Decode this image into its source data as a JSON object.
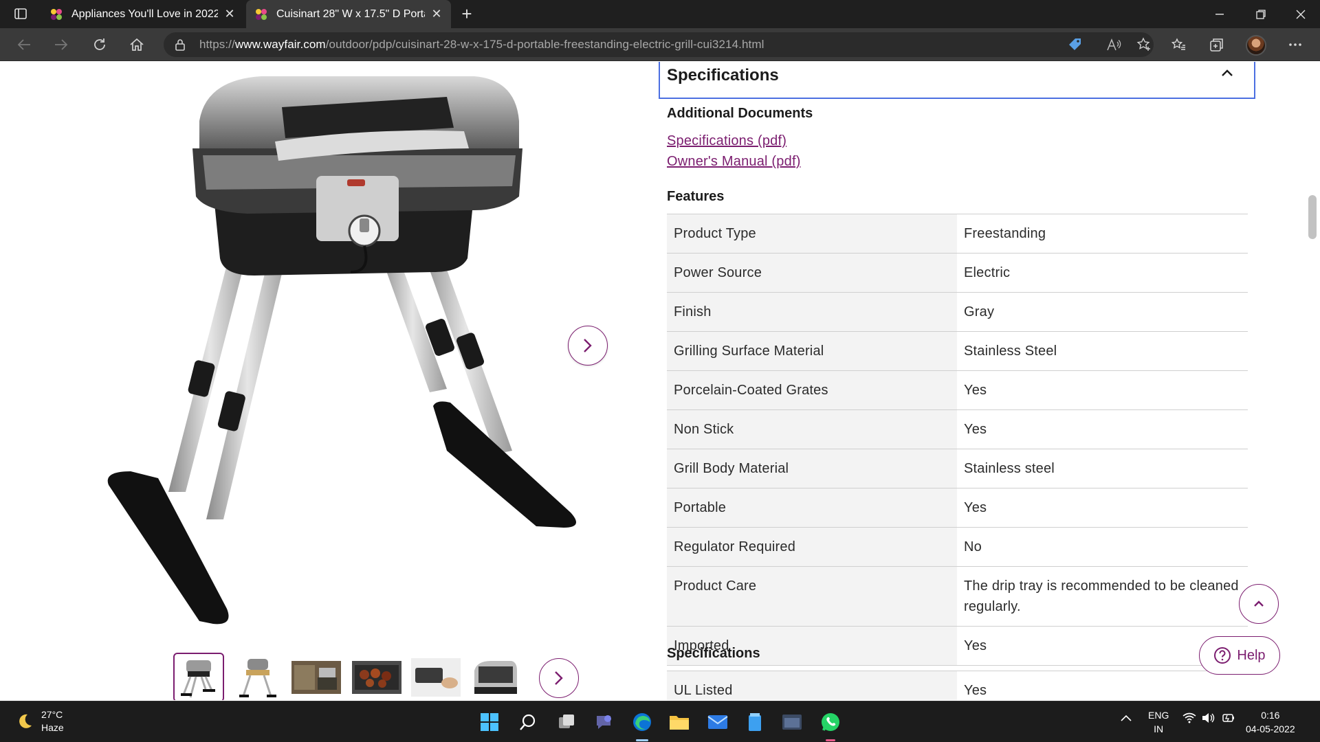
{
  "browser": {
    "tabs": [
      {
        "title": "Appliances You'll Love in 2022 | W",
        "active": false
      },
      {
        "title": "Cuisinart 28\" W x 17.5\" D Portab",
        "active": true
      }
    ],
    "url_prefix": "https://",
    "url_host": "www.wayfair.com",
    "url_path": "/outdoor/pdp/cuisinart-28-w-x-175-d-portable-freestanding-electric-grill-cui3214.html"
  },
  "page": {
    "spec_panel_title": "Specifications",
    "additional_documents": {
      "heading": "Additional Documents",
      "links": [
        "Specifications (pdf)",
        "Owner's Manual (pdf)"
      ]
    },
    "features": {
      "heading": "Features",
      "rows": [
        {
          "label": "Product Type",
          "value": "Freestanding"
        },
        {
          "label": "Power Source",
          "value": "Electric"
        },
        {
          "label": "Finish",
          "value": "Gray"
        },
        {
          "label": "Grilling Surface Material",
          "value": "Stainless Steel"
        },
        {
          "label": "Porcelain-Coated Grates",
          "value": "Yes"
        },
        {
          "label": "Non Stick",
          "value": "Yes"
        },
        {
          "label": "Grill Body Material",
          "value": "Stainless steel"
        },
        {
          "label": "Portable",
          "value": "Yes"
        },
        {
          "label": "Regulator Required",
          "value": "No"
        },
        {
          "label": "Product Care",
          "value": "The drip tray is recommended to be cleaned regularly."
        },
        {
          "label": "Imported",
          "value": "Yes"
        }
      ]
    },
    "specifications": {
      "heading": "Specifications",
      "rows": [
        {
          "label": "UL Listed",
          "value": "Yes"
        }
      ]
    },
    "help_label": "Help"
  },
  "taskbar": {
    "temperature": "27°C",
    "weather": "Haze",
    "language_top": "ENG",
    "language_bottom": "IN",
    "time": "0:16",
    "date": "04-05-2022"
  },
  "colors": {
    "accent": "#7b1d6f",
    "focus_border": "#4b6fe1",
    "table_key_bg": "#f3f3f3"
  }
}
